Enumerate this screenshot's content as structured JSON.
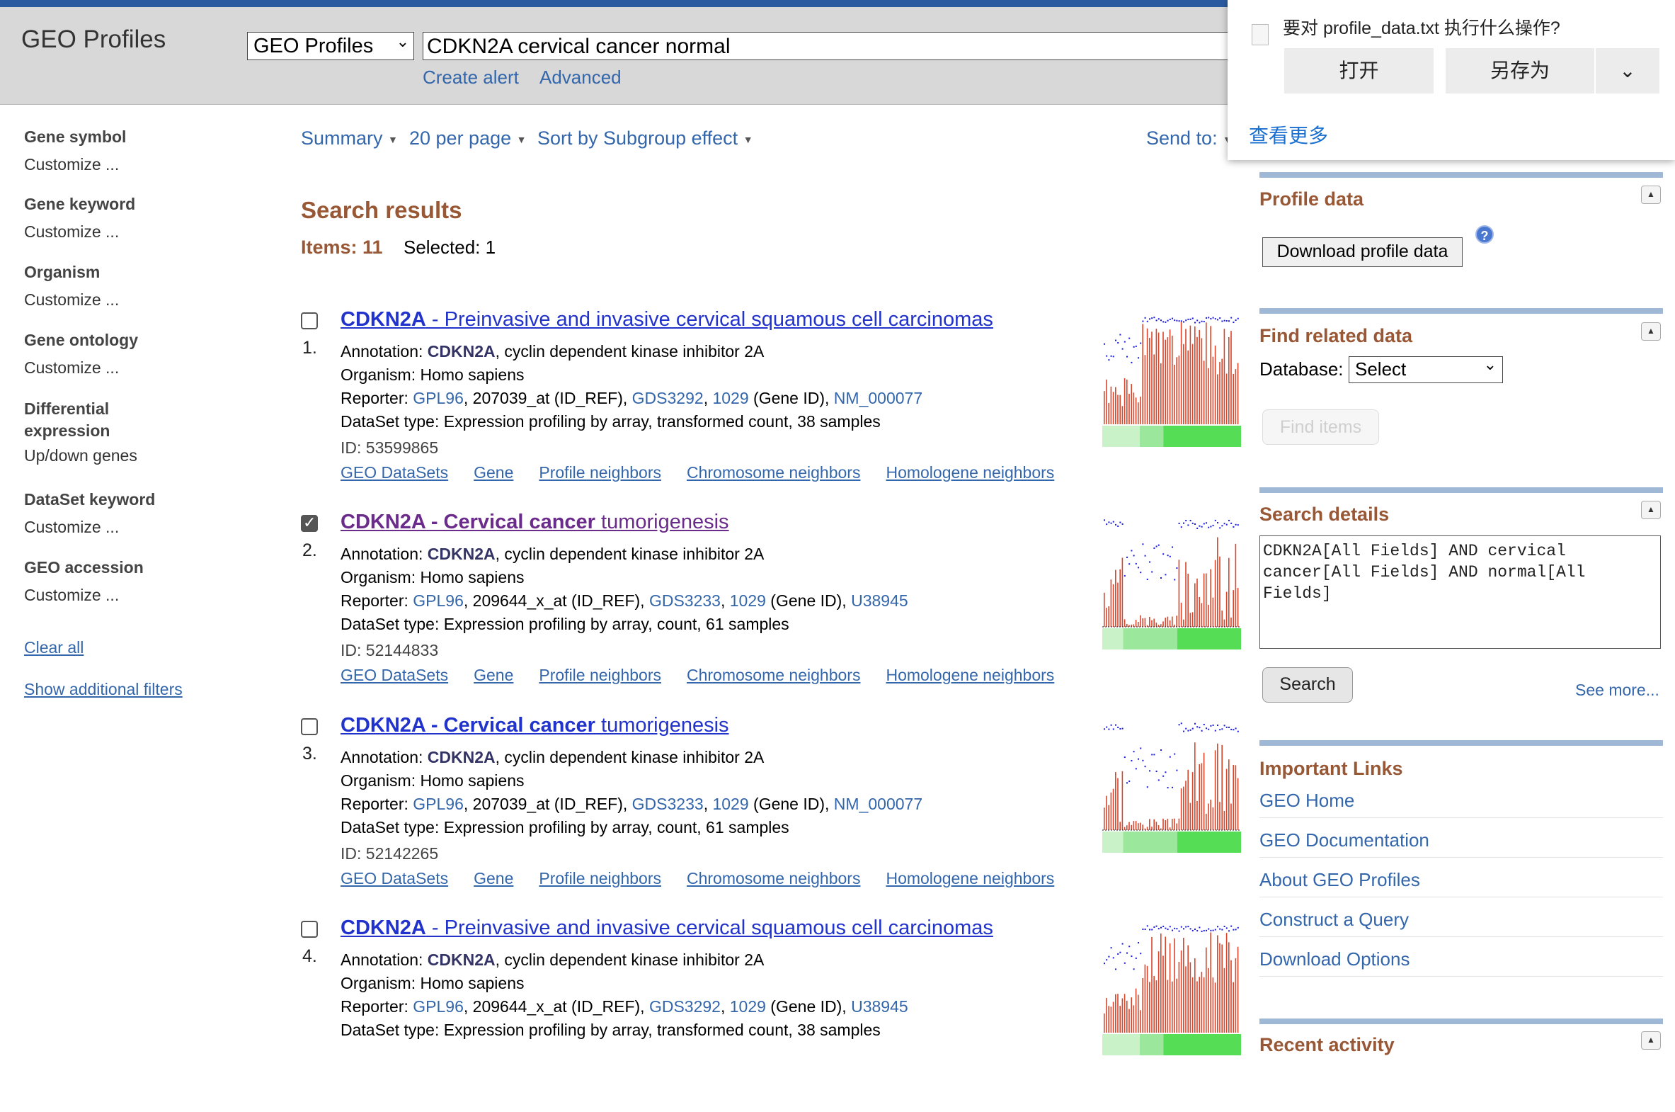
{
  "header": {
    "app_title": "GEO Profiles",
    "db_select_value": "GEO Profiles",
    "search_value": "CDKN2A cervical cancer normal",
    "create_alert": "Create alert",
    "advanced": "Advanced"
  },
  "sidebar": {
    "facets": [
      {
        "title": "Gene symbol",
        "link": "Customize ..."
      },
      {
        "title": "Gene keyword",
        "link": "Customize ..."
      },
      {
        "title": "Organism",
        "link": "Customize ..."
      },
      {
        "title": "Gene ontology",
        "link": "Customize ..."
      },
      {
        "title": "Differential expression",
        "link": "Up/down genes"
      },
      {
        "title": "DataSet keyword",
        "link": "Customize ..."
      },
      {
        "title": "GEO accession",
        "link": "Customize ..."
      }
    ],
    "clear_all": "Clear all",
    "show_filters": "Show additional filters"
  },
  "toolbar": {
    "summary": "Summary",
    "per_page": "20 per page",
    "sort": "Sort by Subgroup effect",
    "send_to": "Send to:"
  },
  "results": {
    "heading": "Search results",
    "items": "Items: 11",
    "selected": "Selected: 1",
    "annotation_label": "Annotation:",
    "organism_label": "Organism:",
    "reporter_label": "Reporter:",
    "dataset_label": "DataSet type:",
    "links": [
      "GEO DataSets",
      "Gene",
      "Profile neighbors",
      "Chromosome neighbors",
      "Homologene neighbors"
    ],
    "list": [
      {
        "num": "1.",
        "gene": "CDKN2A",
        "title_rest": " - Preinvasive and invasive cervical squamous cell carcinomas",
        "gene_bold_full": false,
        "checked": false,
        "annotation_gene": "CDKN2A",
        "annotation_rest": ", cyclin dependent kinase inhibitor 2A",
        "organism": "Homo sapiens",
        "gpl": "GPL96",
        "idref": ", 207039_at (ID_REF), ",
        "gds": "GDS3292",
        "geneid": "1029",
        "geneid_suffix": " (Gene ID), ",
        "acc": "NM_000077",
        "dataset_type": "Expression profiling by array, transformed count, 38 samples",
        "id": "ID: 53599865"
      },
      {
        "num": "2.",
        "gene": "CDKN2A - Cervical cancer",
        "title_rest": " tumorigenesis",
        "gene_bold_full": true,
        "checked": true,
        "annotation_gene": "CDKN2A",
        "annotation_rest": ", cyclin dependent kinase inhibitor 2A",
        "organism": "Homo sapiens",
        "gpl": "GPL96",
        "idref": ", 209644_x_at (ID_REF), ",
        "gds": "GDS3233",
        "geneid": "1029",
        "geneid_suffix": " (Gene ID), ",
        "acc": "U38945",
        "dataset_type": "Expression profiling by array, count, 61 samples",
        "id": "ID: 52144833"
      },
      {
        "num": "3.",
        "gene": "CDKN2A - Cervical cancer",
        "title_rest": " tumorigenesis",
        "gene_bold_full": true,
        "checked": false,
        "annotation_gene": "CDKN2A",
        "annotation_rest": ", cyclin dependent kinase inhibitor 2A",
        "organism": "Homo sapiens",
        "gpl": "GPL96",
        "idref": ", 207039_at (ID_REF), ",
        "gds": "GDS3233",
        "geneid": "1029",
        "geneid_suffix": " (Gene ID), ",
        "acc": "NM_000077",
        "dataset_type": "Expression profiling by array, count, 61 samples",
        "id": "ID: 52142265"
      },
      {
        "num": "4.",
        "gene": "CDKN2A",
        "title_rest": " - Preinvasive and invasive cervical squamous cell carcinomas",
        "gene_bold_full": false,
        "checked": false,
        "annotation_gene": "CDKN2A",
        "annotation_rest": ", cyclin dependent kinase inhibitor 2A",
        "organism": "Homo sapiens",
        "gpl": "GPL96",
        "idref": ", 209644_x_at (ID_REF), ",
        "gds": "GDS3292",
        "geneid": "1029",
        "geneid_suffix": " (Gene ID), ",
        "acc": "U38945",
        "dataset_type": "Expression profiling by array, transformed count, 38 samples",
        "id": ""
      }
    ]
  },
  "right": {
    "profile_data": {
      "title": "Profile data",
      "button": "Download profile data"
    },
    "find_related": {
      "title": "Find related data",
      "db_label": "Database:",
      "db_value": "Select",
      "button": "Find items"
    },
    "search_details": {
      "title": "Search details",
      "query": "CDKN2A[All Fields] AND cervical cancer[All Fields] AND normal[All Fields]",
      "button": "Search",
      "see_more": "See more..."
    },
    "important_links": {
      "title": "Important Links",
      "items": [
        "GEO Home",
        "GEO Documentation",
        "About GEO Profiles",
        "Construct a Query",
        "Download Options"
      ]
    },
    "recent": {
      "title": "Recent activity"
    }
  },
  "download_popup": {
    "message": "要对 profile_data.txt 执行什么操作?",
    "open": "打开",
    "save_as": "另存为",
    "more": "查看更多"
  },
  "colors": {
    "brand_brown": "#985735",
    "link_blue": "#3366aa",
    "bar_red": "#d9452b",
    "dot_blue": "#1a1ae0",
    "group_green_light": "#c9f2c9",
    "group_green_mid": "#9be79b",
    "group_green_dark": "#55dd55"
  }
}
